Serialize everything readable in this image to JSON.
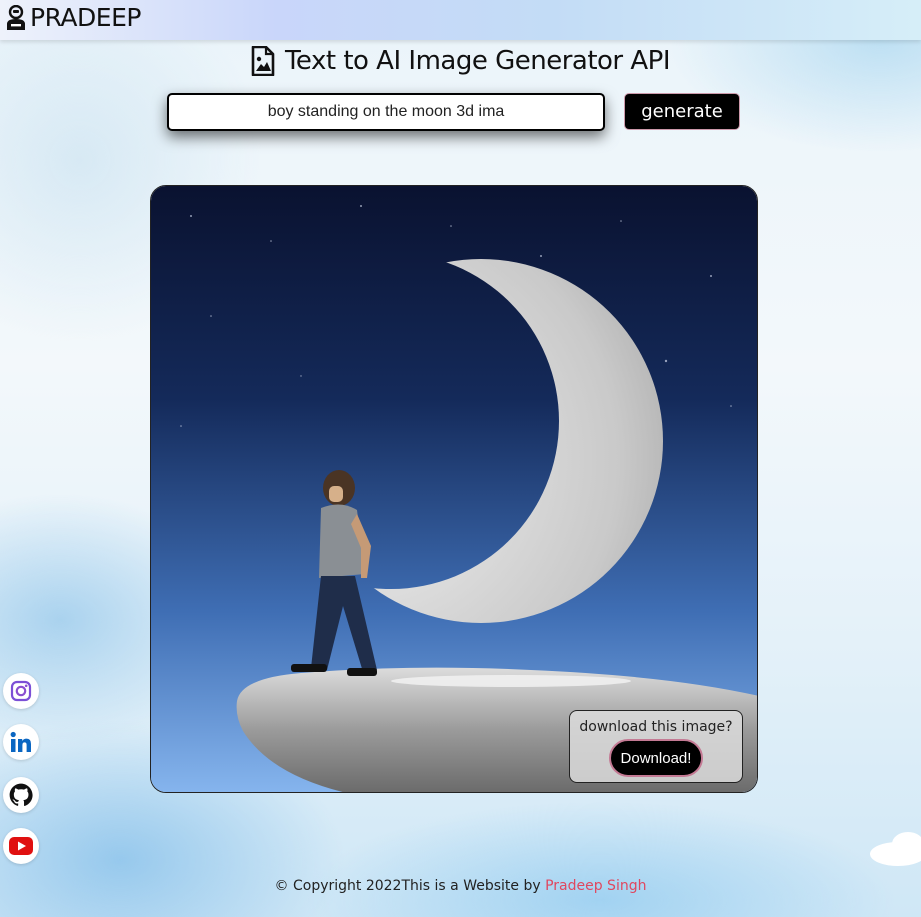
{
  "brand": {
    "name": "PRADEEP",
    "icon": "user-icon"
  },
  "page": {
    "title": "Text to AI Image Generator API",
    "title_icon": "file-image-icon"
  },
  "prompt": {
    "value": "boy standing on the moon 3d ima",
    "placeholder": ""
  },
  "generate": {
    "label": "generate"
  },
  "result": {
    "download_prompt": "download this image?",
    "download_label": "Download!"
  },
  "socials": [
    {
      "name": "instagram-icon",
      "color": "#7b4fd6"
    },
    {
      "name": "linkedin-icon",
      "color": "#0a66c2"
    },
    {
      "name": "github-icon",
      "color": "#111111"
    },
    {
      "name": "youtube-icon",
      "color": "#e01010"
    }
  ],
  "footer": {
    "copyright": "© Copyright 2022This is a Website by ",
    "author": "Pradeep Singh"
  },
  "colors": {
    "accent": "#e0475f",
    "button": "#000000"
  }
}
